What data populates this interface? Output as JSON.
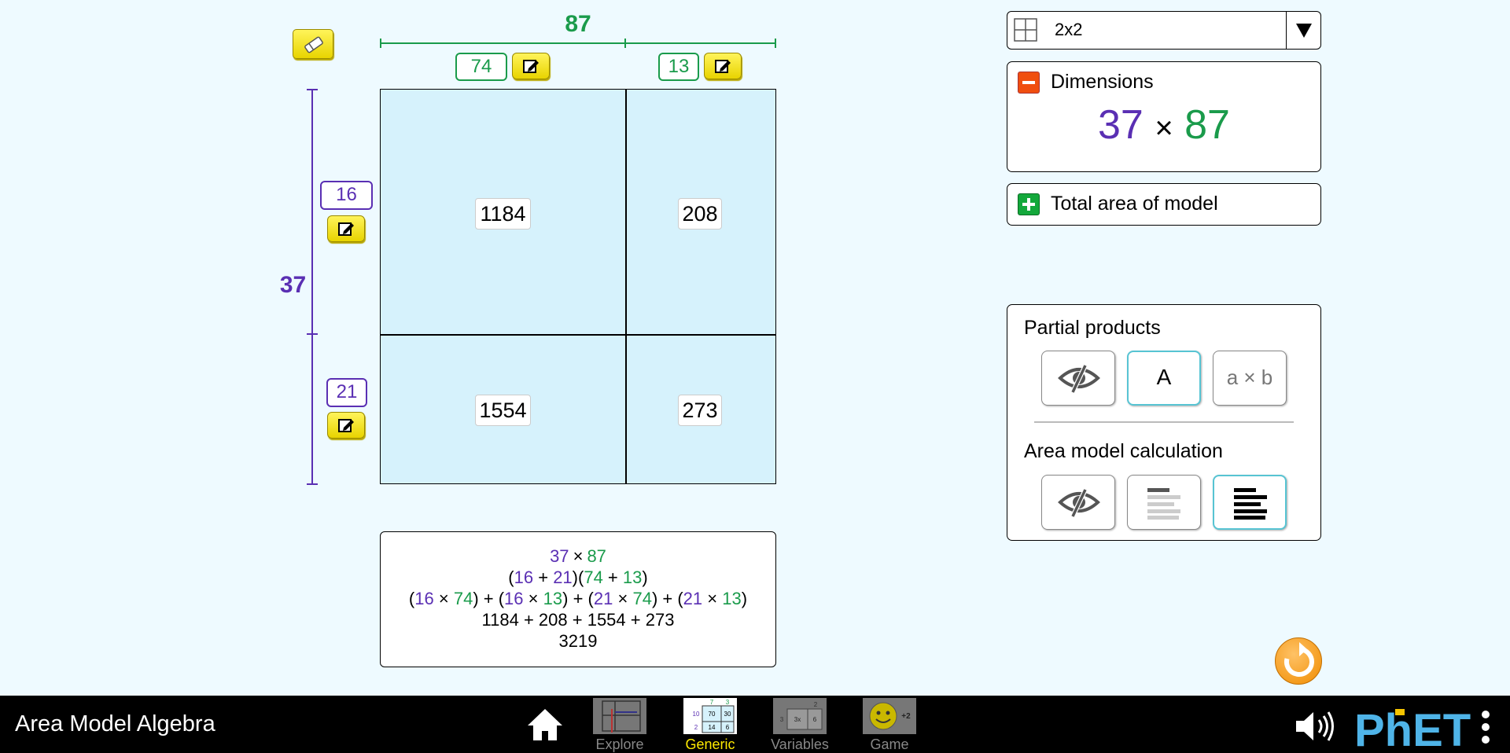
{
  "app": {
    "title": "Area Model Algebra"
  },
  "layout_select": {
    "value": "2x2"
  },
  "dimensions": {
    "width_total": "87",
    "height_total": "37",
    "width_parts": [
      "74",
      "13"
    ],
    "height_parts": [
      "16",
      "21"
    ]
  },
  "products": {
    "top_left": "1184",
    "top_right": "208",
    "bottom_left": "1554",
    "bottom_right": "273"
  },
  "calculation": {
    "line1": {
      "a": "37",
      "op": "×",
      "b": "87"
    },
    "line2": {
      "open1": "(",
      "a1": "16",
      "plus1": " + ",
      "a2": "21",
      "mid": ")(",
      "b1": "74",
      "plus2": " + ",
      "b2": "13",
      "close": ")"
    },
    "line3": {
      "t1a": "16",
      "t1b": "74",
      "t2a": "16",
      "t2b": "13",
      "t3a": "21",
      "t3b": "74",
      "t4a": "21",
      "t4b": "13",
      "times": "×",
      "open": "(",
      "close": ")",
      "plus": " + "
    },
    "line4": "1184 + 208 + 1554 + 273",
    "line5": "3219"
  },
  "dimensions_panel": {
    "title": "Dimensions",
    "expanded": true,
    "left": "37",
    "times": "×",
    "right": "87"
  },
  "total_area_panel": {
    "title": "Total area of model",
    "expanded": false
  },
  "options_panel": {
    "partial_products_title": "Partial products",
    "partial_products_options": [
      "hidden",
      "A",
      "a × b"
    ],
    "partial_products_selected": "A",
    "calc_title": "Area model calculation",
    "calc_options": [
      "hidden",
      "line-by-line",
      "all-lines"
    ],
    "calc_selected": "all-lines",
    "btn_A": "A",
    "btn_axb": "a × b"
  },
  "nav": {
    "tabs": [
      {
        "label": "Explore",
        "active": false
      },
      {
        "label": "Generic",
        "active": true
      },
      {
        "label": "Variables",
        "active": false
      },
      {
        "label": "Game",
        "active": false
      }
    ],
    "game_badge": "+2",
    "generic_thumb": {
      "top": [
        "7",
        "3"
      ],
      "rows": [
        [
          "10",
          "70",
          "30"
        ],
        [
          "2",
          "14",
          "6"
        ]
      ]
    },
    "variables_thumb": {
      "top": "2",
      "left": "3",
      "cells": [
        "3x",
        "6"
      ]
    }
  },
  "brand": {
    "logo_text": "PhET"
  },
  "colors": {
    "purple": "#5a2fb3",
    "green": "#1a9b4b",
    "cell": "#d6f2fc",
    "background": "#eefaff",
    "active_tab": "#ffea00"
  }
}
